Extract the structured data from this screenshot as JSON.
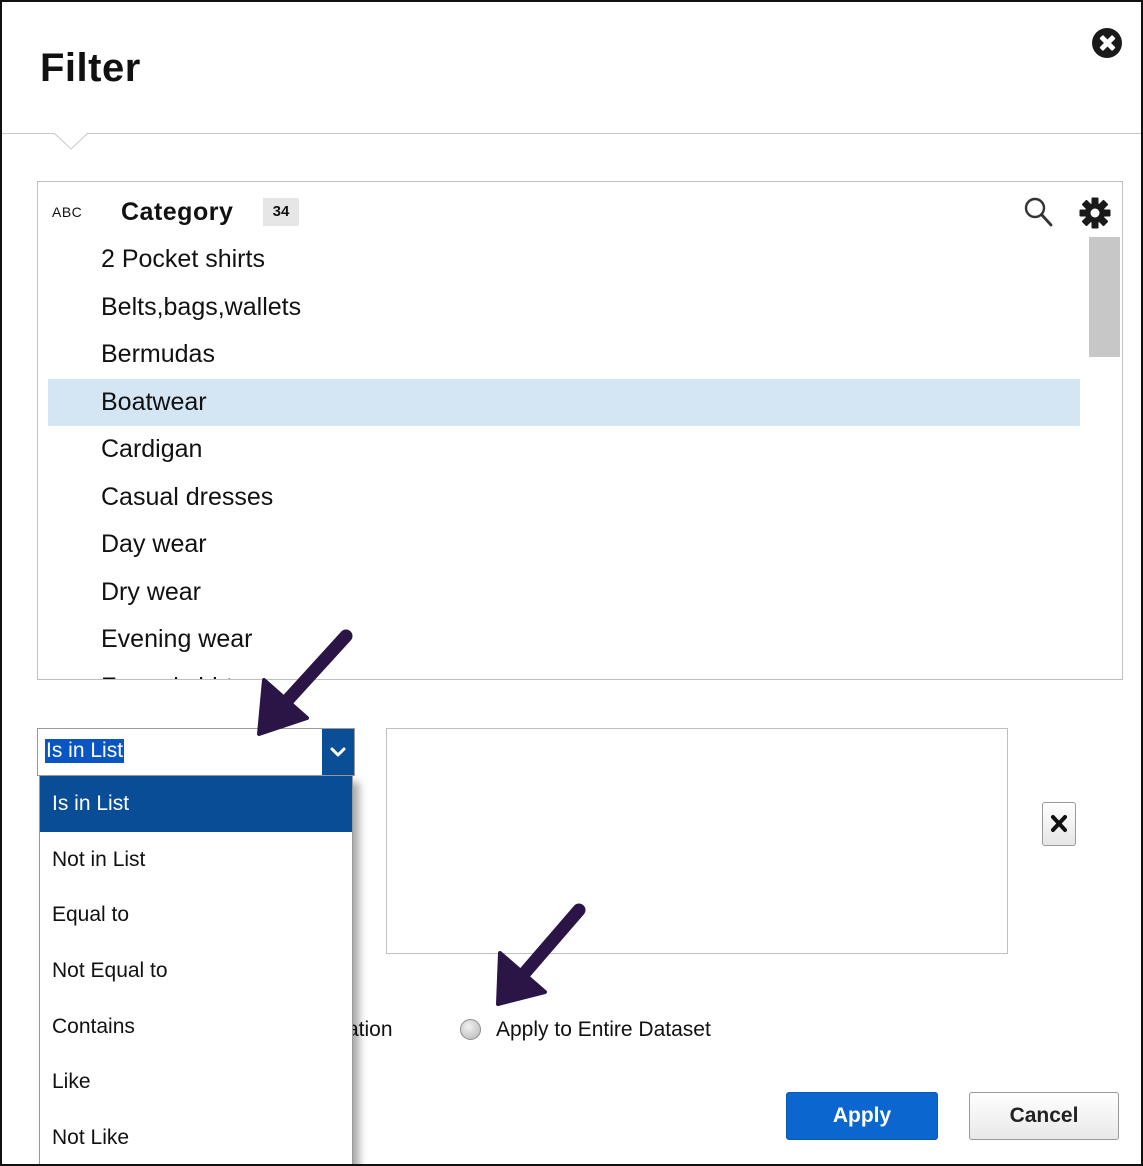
{
  "dialog": {
    "title": "Filter"
  },
  "field": {
    "type_label": "ABC",
    "name": "Category",
    "count": "34"
  },
  "values": [
    "2 Pocket shirts",
    "Belts,bags,wallets",
    "Bermudas",
    "Boatwear",
    "Cardigan",
    "Casual dresses",
    "Day wear",
    "Dry wear",
    "Evening wear",
    "Formal shirts"
  ],
  "selected_value": "Boatwear",
  "operator": {
    "selected": "Is in List",
    "options": [
      "Is in List",
      "Not in List",
      "Equal to",
      "Not Equal to",
      "Contains",
      "Like",
      "Not Like"
    ]
  },
  "scope": {
    "partial_label": "ation",
    "entire_label": "Apply to Entire Dataset"
  },
  "buttons": {
    "apply": "Apply",
    "cancel": "Cancel"
  },
  "icons": {
    "close": "close-icon",
    "search": "search-icon",
    "settings": "gear-icon",
    "remove": "remove-x-icon",
    "dropdown": "chevron-down-icon"
  },
  "colors": {
    "accent": "#0b66cf",
    "selected_row": "#d4e6f4",
    "active_option": "#0a4d97",
    "annotation_arrow": "#2b1547"
  }
}
